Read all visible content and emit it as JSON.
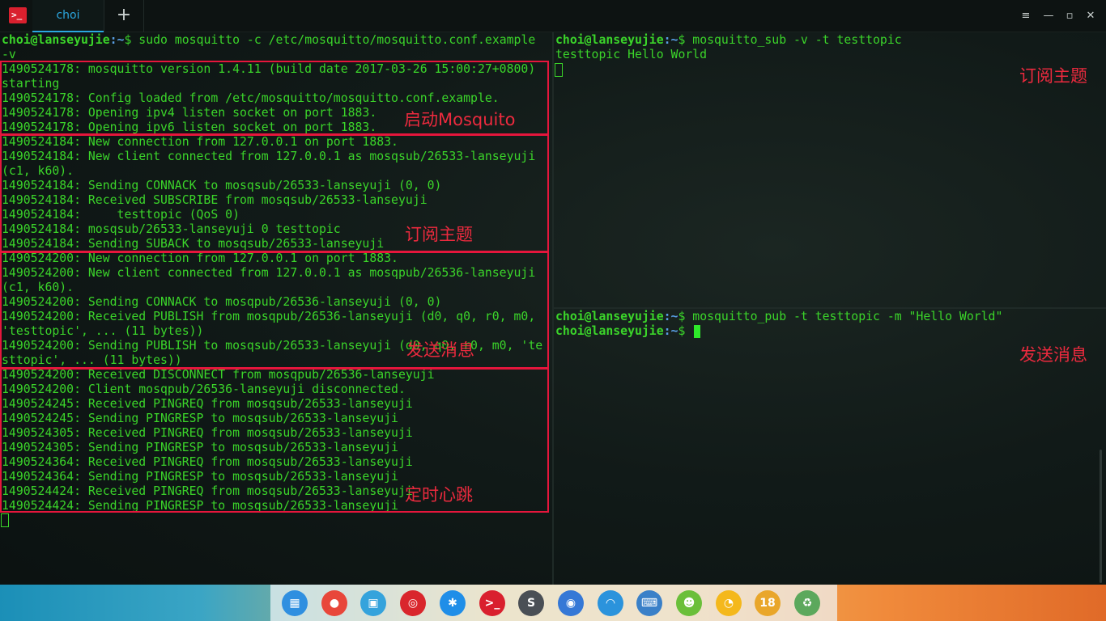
{
  "window": {
    "tab_label": "choi",
    "add_tab_glyph": "+",
    "controls": [
      "≡",
      "—",
      "▫",
      "✕"
    ],
    "app_icon_glyph": ">_"
  },
  "left_pane": {
    "prompt_user": "choi@lanseyujie",
    "prompt_path": ":~",
    "prompt_symbol": "$",
    "command": " sudo mosquitto -c /etc/mosquitto/mosquitto.conf.example",
    "lines": [
      "-v",
      "1490524178: mosquitto version 1.4.11 (build date 2017-03-26 15:00:27+0800)",
      "starting",
      "1490524178: Config loaded from /etc/mosquitto/mosquitto.conf.example.",
      "1490524178: Opening ipv4 listen socket on port 1883.",
      "1490524178: Opening ipv6 listen socket on port 1883.",
      "1490524184: New connection from 127.0.0.1 on port 1883.",
      "1490524184: New client connected from 127.0.0.1 as mosqsub/26533-lanseyuji",
      "(c1, k60).",
      "1490524184: Sending CONNACK to mosqsub/26533-lanseyuji (0, 0)",
      "1490524184: Received SUBSCRIBE from mosqsub/26533-lanseyuji",
      "1490524184:     testtopic (QoS 0)",
      "1490524184: mosqsub/26533-lanseyuji 0 testtopic",
      "1490524184: Sending SUBACK to mosqsub/26533-lanseyuji",
      "1490524200: New connection from 127.0.0.1 on port 1883.",
      "1490524200: New client connected from 127.0.0.1 as mosqpub/26536-lanseyuji",
      "(c1, k60).",
      "1490524200: Sending CONNACK to mosqpub/26536-lanseyuji (0, 0)",
      "1490524200: Received PUBLISH from mosqpub/26536-lanseyuji (d0, q0, r0, m0,",
      "'testtopic', ... (11 bytes))",
      "1490524200: Sending PUBLISH to mosqsub/26533-lanseyuji (d0, q0, r0, m0, 'te",
      "sttopic', ... (11 bytes))",
      "1490524200: Received DISCONNECT from mosqpub/26536-lanseyuji",
      "1490524200: Client mosqpub/26536-lanseyuji disconnected.",
      "1490524245: Received PINGREQ from mosqsub/26533-lanseyuji",
      "1490524245: Sending PINGRESP to mosqsub/26533-lanseyuji",
      "1490524305: Received PINGREQ from mosqsub/26533-lanseyuji",
      "1490524305: Sending PINGRESP to mosqsub/26533-lanseyuji",
      "1490524364: Received PINGREQ from mosqsub/26533-lanseyuji",
      "1490524364: Sending PINGRESP to mosqsub/26533-lanseyuji",
      "1490524424: Received PINGREQ from mosqsub/26533-lanseyuji",
      "1490524424: Sending PINGRESP to mosqsub/26533-lanseyuji"
    ]
  },
  "right_top_pane": {
    "prompt_user": "choi@lanseyujie",
    "prompt_path": ":~",
    "prompt_symbol": "$",
    "command": " mosquitto_sub -v -t testtopic",
    "output": "testtopic Hello World"
  },
  "right_bottom_pane": {
    "prompt_user": "choi@lanseyujie",
    "prompt_path": ":~",
    "prompt_symbol": "$",
    "command": " mosquitto_pub -t testtopic -m \"Hello World\"",
    "prompt2_user": "choi@lanseyujie",
    "prompt2_path": ":~",
    "prompt2_symbol": "$"
  },
  "annotations": {
    "start": "启动Mosquito",
    "subscribe": "订阅主题",
    "publish": "发送消息",
    "heartbeat": "定时心跳",
    "right_subscribe": "订阅主题",
    "right_publish": "发送消息"
  },
  "colors": {
    "terminal_green": "#3bd52a",
    "prompt_path_blue": "#5aa0e6",
    "annotation_red": "#e5163c",
    "tab_accent": "#2ba7e0"
  },
  "dock": {
    "icons": [
      {
        "name": "launcher-icon",
        "glyph": "▦",
        "color": "#2f8fe0"
      },
      {
        "name": "chrome-icon",
        "glyph": "●",
        "color": "#e8463a"
      },
      {
        "name": "file-manager-icon",
        "glyph": "▣",
        "color": "#35a3dc"
      },
      {
        "name": "netease-music-icon",
        "glyph": "◎",
        "color": "#d9262c"
      },
      {
        "name": "dingtalk-icon",
        "glyph": "✱",
        "color": "#1f8ee8"
      },
      {
        "name": "terminal-icon",
        "glyph": ">_",
        "color": "#d9202e"
      },
      {
        "name": "sublime-icon",
        "glyph": "S",
        "color": "#4a4f55"
      },
      {
        "name": "browser-icon",
        "glyph": "◉",
        "color": "#3578d6"
      },
      {
        "name": "wifi-icon",
        "glyph": "◠",
        "color": "#2b93dc"
      },
      {
        "name": "keyboard-icon",
        "glyph": "⌨",
        "color": "#3a80c8"
      },
      {
        "name": "android-icon",
        "glyph": "☻",
        "color": "#6bbf3a"
      },
      {
        "name": "emoji-icon",
        "glyph": "◔",
        "color": "#f4b81c"
      },
      {
        "name": "clock-icon",
        "glyph": "18",
        "color": "#e9a62a"
      },
      {
        "name": "trash-icon",
        "glyph": "♻",
        "color": "#5ca85c"
      }
    ]
  }
}
